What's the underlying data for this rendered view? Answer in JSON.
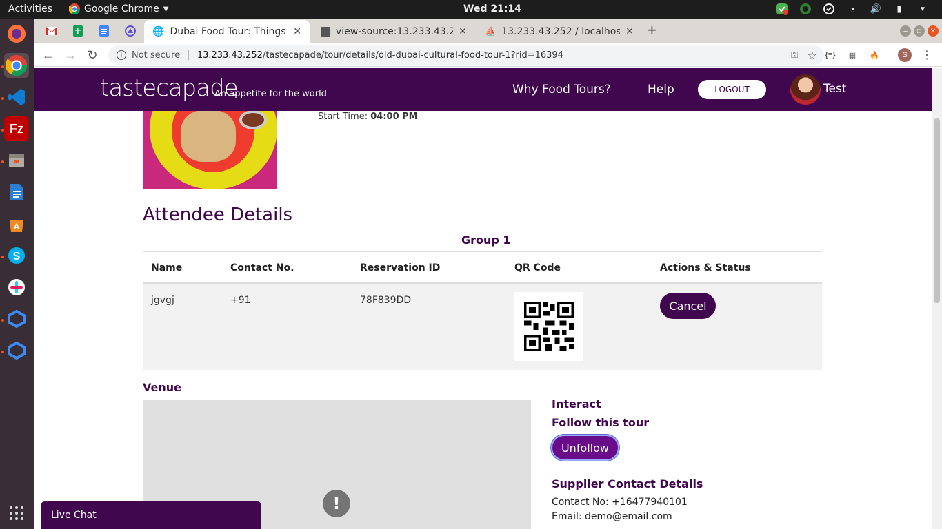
{
  "os": {
    "activities": "Activities",
    "app_menu": "Google Chrome",
    "clock": "Wed 21:14"
  },
  "browser": {
    "tabs": [
      {
        "title": "Dubai Food Tour: Things t",
        "active": true
      },
      {
        "title": "view-source:13.233.43.25",
        "active": false
      },
      {
        "title": "13.233.43.252 / localhost /",
        "active": false
      }
    ],
    "new_tab": "+",
    "not_secure": "Not secure",
    "url_host": "13.233.43.252",
    "url_path": "/tastecapade/tour/details/old-dubai-cultural-food-tour-1?rid=16394",
    "profile_initial": "S"
  },
  "site": {
    "logo": "tastecapade",
    "tagline": "An appetite for the world",
    "nav": [
      "Why Food Tours?",
      "Help"
    ],
    "logout": "LOGOUT",
    "user": "Test"
  },
  "tour": {
    "start_time_label": "Start Time:",
    "start_time_value": "04:00 PM"
  },
  "attendees": {
    "title": "Attendee Details",
    "group": "Group 1",
    "columns": [
      "Name",
      "Contact No.",
      "Reservation ID",
      "QR Code",
      "Actions & Status"
    ],
    "rows": [
      {
        "name": "jgvgj",
        "contact": "+91",
        "reservation_id": "78F839DD",
        "action": "Cancel"
      }
    ]
  },
  "venue": {
    "title": "Venue"
  },
  "interact": {
    "title": "Interact",
    "follow_label": "Follow this tour",
    "unfollow": "Unfollow"
  },
  "supplier": {
    "title": "Supplier Contact Details",
    "contact": "Contact No: +16477940101",
    "email": "Email: demo@email.com"
  },
  "livechat": "Live Chat",
  "colors": {
    "brand": "#40064e",
    "unfollow": "#6a0b8a"
  }
}
